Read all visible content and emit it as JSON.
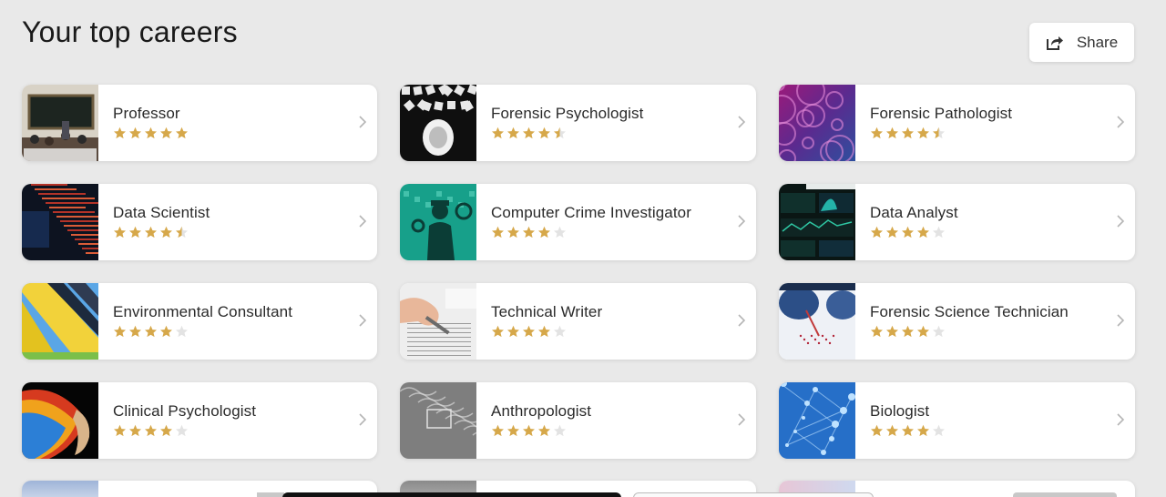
{
  "page": {
    "title": "Your top careers"
  },
  "share": {
    "label": "Share",
    "icon": "share-icon"
  },
  "colors": {
    "star": "#d6a84a",
    "star_empty": "#e3e3e3",
    "chevron": "#b5b5b5"
  },
  "careers": [
    {
      "title": "Professor",
      "rating": 5,
      "thumb": "classroom"
    },
    {
      "title": "Forensic Psychologist",
      "rating": 4.5,
      "thumb": "puzzle-head"
    },
    {
      "title": "Forensic Pathologist",
      "rating": 4.5,
      "thumb": "cells"
    },
    {
      "title": "Data Scientist",
      "rating": 4.5,
      "thumb": "data-stream"
    },
    {
      "title": "Computer Crime Investigator",
      "rating": 4,
      "thumb": "detective"
    },
    {
      "title": "Data Analyst",
      "rating": 4,
      "thumb": "dashboard"
    },
    {
      "title": "Environmental Consultant",
      "rating": 4,
      "thumb": "solar-field"
    },
    {
      "title": "Technical Writer",
      "rating": 4,
      "thumb": "writing-hand"
    },
    {
      "title": "Forensic Science Technician",
      "rating": 4,
      "thumb": "lab-gloves"
    },
    {
      "title": "Clinical Psychologist",
      "rating": 4,
      "thumb": "colorful-face"
    },
    {
      "title": "Anthropologist",
      "rating": 4,
      "thumb": "stone-carving"
    },
    {
      "title": "Biologist",
      "rating": 4,
      "thumb": "molecules"
    }
  ]
}
